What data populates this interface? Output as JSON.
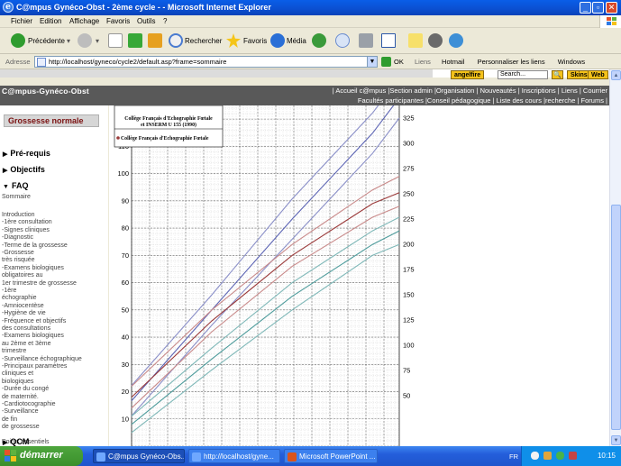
{
  "window": {
    "title": "C@mpus Gynéco-Obst - 2ème cycle - - Microsoft Internet Explorer"
  },
  "menu": [
    "Fichier",
    "Edition",
    "Affichage",
    "Favoris",
    "Outils",
    "?"
  ],
  "toolbar": {
    "back": "Précédente",
    "search": "Rechercher",
    "favorites": "Favoris",
    "media": "Média"
  },
  "address": {
    "label": "Adresse",
    "url": "http://localhost/gyneco/cycle2/default.asp?frame=sommaire",
    "go": "OK",
    "links_label": "Liens",
    "links": [
      "Hotmail",
      "Personnaliser les liens",
      "Windows"
    ]
  },
  "site": {
    "angelfire": "angelfire",
    "search_placeholder": "Search...",
    "skins": "Skins",
    "web": "Web",
    "brand": "C@mpus-Gynéco-Obst",
    "nav1": [
      "Accueil c@mpus",
      "Section admin",
      "Organisation",
      "Nouveautés",
      "Inscriptions",
      "Liens",
      "Courrier"
    ],
    "nav2": [
      "Facultés participantes",
      "Conseil pédagogique",
      "Liste des cours",
      "recherche",
      "Forums"
    ]
  },
  "left": {
    "section": "Grossesse normale",
    "headings": [
      "Pré-requis",
      "Objectifs",
      "FAQ",
      "QCM"
    ],
    "sommaire": "Sommaire",
    "items": [
      "Introduction",
      "-1ère consultation",
      "-Signes cliniques",
      "-Diagnostic",
      "-Terme de la grossesse",
      "-Grossesse",
      "très risquée",
      "-Examens biologiques",
      "obligatoires au",
      "1er trimestre de grossesse",
      "-1ère",
      "échographie",
      "-Amniocentèse",
      "-Hygiène de vie",
      "-Fréquence et objectifs",
      "des consultations",
      "-Examens biologiques",
      "au 2ème et 3ème",
      "trimestre",
      "-Surveillance échographique",
      "-Principaux paramètres",
      "cliniques et",
      "biologiques",
      "-Durée du congé",
      "de maternité.",
      "-Cardiotocographie",
      "-Surveillance",
      "de fin",
      "de grossesse",
      "",
      "Points essentiels"
    ]
  },
  "chart_data": {
    "type": "line",
    "legend_box": [
      "Collège Français d'Echographie Fœtale",
      "et INSERM U 155 (1990)",
      "Collège Français d'Echographie Fœtale"
    ],
    "y_left_ticks": [
      10,
      20,
      30,
      40,
      50,
      60,
      70,
      80,
      90,
      100,
      110,
      120
    ],
    "y_right_ticks": [
      50,
      75,
      100,
      125,
      150,
      175,
      200,
      225,
      250,
      275,
      300,
      325
    ],
    "ylim_left": [
      0,
      125
    ],
    "ylim_right": [
      0,
      337.5
    ],
    "xlim": [
      0,
      100
    ],
    "grid": "on",
    "series": [
      {
        "color": "#8a8fc8",
        "axis": "right",
        "x": [
          0,
          30,
          60,
          90,
          100
        ],
        "values": [
          30,
          120,
          205,
          290,
          325
        ]
      },
      {
        "color": "#5c64b4",
        "axis": "right",
        "x": [
          0,
          30,
          60,
          90,
          100
        ],
        "values": [
          45,
          135,
          225,
          310,
          345
        ]
      },
      {
        "color": "#8a8fc8",
        "axis": "right",
        "x": [
          0,
          30,
          60,
          90,
          100
        ],
        "values": [
          60,
          150,
          245,
          330,
          365
        ]
      },
      {
        "color": "#c98a8a",
        "axis": "left",
        "x": [
          0,
          30,
          60,
          90,
          100
        ],
        "values": [
          14,
          42,
          66,
          84,
          88
        ]
      },
      {
        "color": "#9b3a3a",
        "axis": "left",
        "x": [
          0,
          30,
          60,
          90,
          100
        ],
        "values": [
          18,
          46,
          70,
          89,
          93
        ]
      },
      {
        "color": "#c98a8a",
        "axis": "left",
        "x": [
          0,
          30,
          60,
          90,
          100
        ],
        "values": [
          22,
          50,
          74,
          94,
          99
        ]
      },
      {
        "color": "#7fb8b8",
        "axis": "left",
        "x": [
          0,
          30,
          60,
          90,
          100
        ],
        "values": [
          5,
          28,
          50,
          70,
          74
        ]
      },
      {
        "color": "#4e9c9c",
        "axis": "left",
        "x": [
          0,
          30,
          60,
          90,
          100
        ],
        "values": [
          8,
          32,
          55,
          74,
          79
        ]
      },
      {
        "color": "#7fb8b8",
        "axis": "left",
        "x": [
          0,
          30,
          60,
          90,
          100
        ],
        "values": [
          11,
          36,
          60,
          79,
          84
        ]
      }
    ]
  },
  "taskbar": {
    "start": "démarrer",
    "tasks": [
      "C@mpus Gynéco-Obs...",
      "http://localhost/gyne...",
      "Microsoft PowerPoint ..."
    ],
    "lang": "FR",
    "clock": "10:15"
  },
  "colors": {
    "title_blue": "#0b4fd0",
    "nav_gray": "#595959",
    "section_red": "#7a1010",
    "taskbar_blue": "#245edb",
    "start_green": "#3a8f2b"
  }
}
